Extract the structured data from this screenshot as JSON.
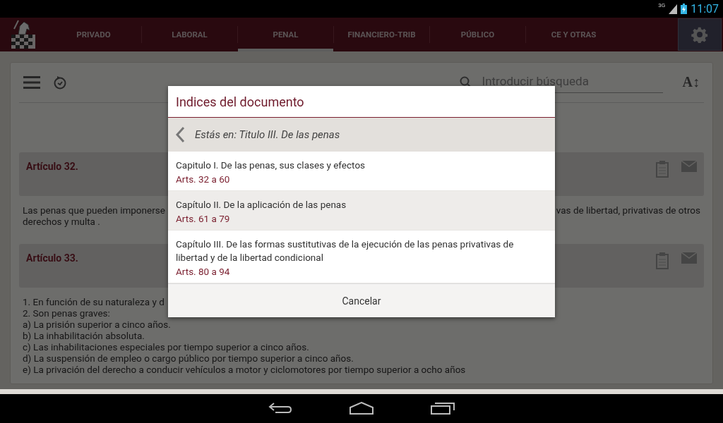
{
  "status_bar": {
    "network": "3G",
    "time": "11:07"
  },
  "tabs": [
    {
      "label": "PRIVADO",
      "selected": false
    },
    {
      "label": "LABORAL",
      "selected": false
    },
    {
      "label": "PENAL",
      "selected": true
    },
    {
      "label": "FINANCIERO-TRIB",
      "selected": false
    },
    {
      "label": "PÚBLICO",
      "selected": false
    },
    {
      "label": "CE Y OTRAS",
      "selected": false
    }
  ],
  "toolbar": {
    "search_placeholder": "Introducir búsqueda",
    "font_button": "A↕"
  },
  "articles": [
    {
      "title": "Artículo 32.",
      "lines": [
        [
          "Las penas que pueden imponerse",
          "vas de libertad, privativas de otros"
        ],
        [
          "derechos y multa ."
        ]
      ]
    },
    {
      "title": "Artículo 33.",
      "lines": [
        [
          "1. En función de su naturaleza y d"
        ],
        [
          "2. Son penas graves:"
        ],
        [
          "a) La prisión superior a cinco años."
        ],
        [
          "b) La inhabilitación absoluta."
        ],
        [
          "c) Las inhabilitaciones especiales por tiempo superior a cinco años."
        ],
        [
          "d) La suspensión de empleo o cargo público por tiempo superior a cinco años."
        ],
        [
          "e) La privación del derecho a conducir vehículos a motor y ciclomotores por tiempo superior a ocho años"
        ]
      ]
    }
  ],
  "dialog": {
    "title": "Indices del documento",
    "breadcrumb": "Estás en: Titulo III. De las penas",
    "items": [
      {
        "title": "Capitulo I. De las penas, sus clases y efectos",
        "range": "Arts. 32 a 60",
        "selected": false
      },
      {
        "title": "Capítulo II. De la aplicación de las penas",
        "range": "Arts. 61 a 79",
        "selected": true
      },
      {
        "title": "Capítulo III. De las formas sustitutivas de la ejecución de las penas privativas de libertad y de la libertad condicional",
        "range": "Arts. 80 a 94",
        "selected": false
      }
    ],
    "cancel": "Cancelar"
  }
}
